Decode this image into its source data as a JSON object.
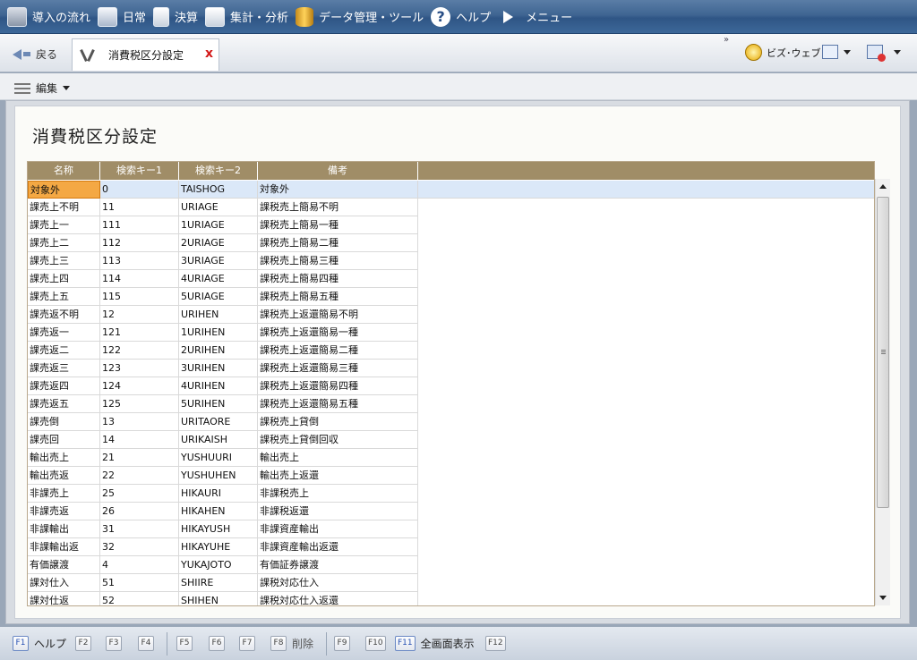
{
  "menu": [
    {
      "label": "導入の流れ",
      "icon": "flow-icon"
    },
    {
      "label": "日常",
      "icon": "daily-icon"
    },
    {
      "label": "決算",
      "icon": "closing-icon"
    },
    {
      "label": "集計・分析",
      "icon": "statistics-icon"
    },
    {
      "label": "データ管理・ツール",
      "icon": "database-icon"
    },
    {
      "label": "ヘルプ",
      "icon": "help-icon"
    },
    {
      "label": "メニュー",
      "icon": "menu-arrow-icon"
    }
  ],
  "tabrow": {
    "back_label": "戻る",
    "tab_label": "消費税区分設定",
    "tab_close": "x",
    "overflow": "»",
    "bizweb_label": "ビズ･ウェブ"
  },
  "editbar": {
    "label": "編集"
  },
  "page": {
    "title": "消費税区分設定"
  },
  "table": {
    "headers": [
      "名称",
      "検索キー1",
      "検索キー2",
      "備考"
    ],
    "rows": [
      [
        "対象外",
        "0",
        "TAISHOG",
        "対象外"
      ],
      [
        "課売上不明",
        "11",
        "URIAGE",
        "課税売上簡易不明"
      ],
      [
        "課売上一",
        "111",
        "1URIAGE",
        "課税売上簡易一種"
      ],
      [
        "課売上二",
        "112",
        "2URIAGE",
        "課税売上簡易二種"
      ],
      [
        "課売上三",
        "113",
        "3URIAGE",
        "課税売上簡易三種"
      ],
      [
        "課売上四",
        "114",
        "4URIAGE",
        "課税売上簡易四種"
      ],
      [
        "課売上五",
        "115",
        "5URIAGE",
        "課税売上簡易五種"
      ],
      [
        "課売返不明",
        "12",
        "URIHEN",
        "課税売上返還簡易不明"
      ],
      [
        "課売返一",
        "121",
        "1URIHEN",
        "課税売上返還簡易一種"
      ],
      [
        "課売返二",
        "122",
        "2URIHEN",
        "課税売上返還簡易二種"
      ],
      [
        "課売返三",
        "123",
        "3URIHEN",
        "課税売上返還簡易三種"
      ],
      [
        "課売返四",
        "124",
        "4URIHEN",
        "課税売上返還簡易四種"
      ],
      [
        "課売返五",
        "125",
        "5URIHEN",
        "課税売上返還簡易五種"
      ],
      [
        "課売倒",
        "13",
        "URITAORE",
        "課税売上貸倒"
      ],
      [
        "課売回",
        "14",
        "URIKAISH",
        "課税売上貸倒回収"
      ],
      [
        "輸出売上",
        "21",
        "YUSHUURI",
        "輸出売上"
      ],
      [
        "輸出売返",
        "22",
        "YUSHUHEN",
        "輸出売上返還"
      ],
      [
        "非課売上",
        "25",
        "HIKAURI",
        "非課税売上"
      ],
      [
        "非課売返",
        "26",
        "HIKAHEN",
        "非課税返還"
      ],
      [
        "非課輸出",
        "31",
        "HIKAYUSH",
        "非課資産輸出"
      ],
      [
        "非課輸出返",
        "32",
        "HIKAYUHE",
        "非課資産輸出返還"
      ],
      [
        "有価譲渡",
        "4",
        "YUKAJOTO",
        "有価証券譲渡"
      ],
      [
        "課対仕入",
        "51",
        "SHIIRE",
        "課税対応仕入"
      ],
      [
        "課対仕返",
        "52",
        "SHIHEN",
        "課税対応仕入返還"
      ]
    ]
  },
  "fkeys": [
    {
      "key": "F1",
      "label": "ヘルプ"
    },
    {
      "key": "F2",
      "label": ""
    },
    {
      "key": "F3",
      "label": ""
    },
    {
      "key": "F4",
      "label": ""
    },
    {
      "key": "F5",
      "label": ""
    },
    {
      "key": "F6",
      "label": ""
    },
    {
      "key": "F7",
      "label": ""
    },
    {
      "key": "F8",
      "label": "削除"
    },
    {
      "key": "F9",
      "label": ""
    },
    {
      "key": "F10",
      "label": ""
    },
    {
      "key": "F11",
      "label": "全画面表示"
    },
    {
      "key": "F12",
      "label": ""
    }
  ]
}
